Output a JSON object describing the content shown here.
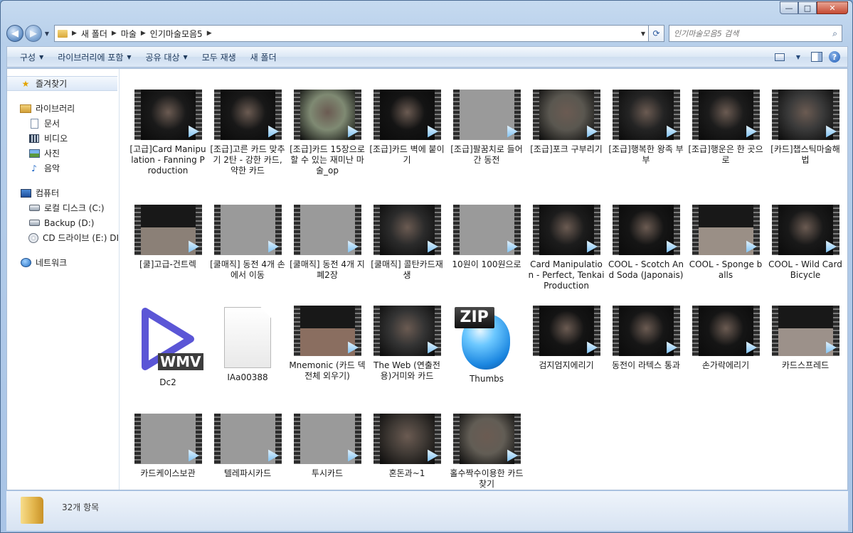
{
  "window": {
    "caption": {
      "minimize": "—",
      "maximize": "□",
      "close": "✕"
    }
  },
  "address": {
    "crumbs": [
      "새 폴더",
      "마술",
      "인기마술모음5"
    ],
    "search_placeholder": "인기마술모음5 검색"
  },
  "toolbar": {
    "organize": "구성",
    "include_library": "라이브러리에 포함",
    "share": "공유 대상",
    "play_all": "모두 재생",
    "new_folder": "새 폴더"
  },
  "nav": {
    "favorites": "즐겨찾기",
    "libraries": "라이브러리",
    "documents": "문서",
    "videos": "비디오",
    "pictures": "사진",
    "music": "음악",
    "computer": "컴퓨터",
    "local_disk": "로컬 디스크 (C:)",
    "backup": "Backup (D:)",
    "cd_drive": "CD 드라이브 (E:) DI",
    "network": "네트워크"
  },
  "files": [
    {
      "name": "[고급]Card Manipulation - Fanning Production",
      "type": "video"
    },
    {
      "name": "[조급]고른 카드 맞추기 2탄 - 강한 카드, 약한 카드",
      "type": "video"
    },
    {
      "name": "[조급]카드 15장으로 할 수 있는 재미난 마술_op",
      "type": "video"
    },
    {
      "name": "[조급]카드 벽에 붙이기",
      "type": "video"
    },
    {
      "name": "[조급]팔꿈치로 들어간 동전",
      "type": "video-blank"
    },
    {
      "name": "[조급]포크 구부리기",
      "type": "video"
    },
    {
      "name": "[조급]행복한 왕족 부부",
      "type": "video"
    },
    {
      "name": "[조급]행운은 한 곳으로",
      "type": "video"
    },
    {
      "name": "[카드]챕스틱마술해법",
      "type": "video"
    },
    {
      "name": "[쿨]고급-건트렉",
      "type": "video"
    },
    {
      "name": "[쿨매직] 동전 4개 손에서 이동",
      "type": "video-blank"
    },
    {
      "name": "[쿨매직] 동전 4개 지폐2장",
      "type": "video-blank"
    },
    {
      "name": "[쿨매직] 콜탄카드재생",
      "type": "video"
    },
    {
      "name": "10원이 100원으로",
      "type": "video-blank"
    },
    {
      "name": "Card Manipulation - Perfect, Tenkai Production",
      "type": "video"
    },
    {
      "name": "COOL - Scotch And Soda (Japonais)",
      "type": "video"
    },
    {
      "name": "COOL - Sponge balls",
      "type": "video"
    },
    {
      "name": "COOL - Wild Card Bicycle",
      "type": "video"
    },
    {
      "name": "Dc2",
      "type": "wmv"
    },
    {
      "name": "IAa00388",
      "type": "blank"
    },
    {
      "name": "Mnemonic (카드 덱 전체 외우기)",
      "type": "video"
    },
    {
      "name": "The Web (연출전용)거미와 카드",
      "type": "video"
    },
    {
      "name": "Thumbs",
      "type": "zip"
    },
    {
      "name": "검지엄지에리기",
      "type": "video"
    },
    {
      "name": "동전이 라텍스 통과",
      "type": "video"
    },
    {
      "name": "손가락에리기",
      "type": "video"
    },
    {
      "name": "카드스프레드",
      "type": "video"
    },
    {
      "name": "카드케이스보관",
      "type": "video-blank"
    },
    {
      "name": "텔레파시카드",
      "type": "video-blank"
    },
    {
      "name": "투시카드",
      "type": "video-blank"
    },
    {
      "name": "혼돈과~1",
      "type": "video"
    },
    {
      "name": "홀수짝수이용한 카드찾기",
      "type": "video"
    }
  ],
  "labels": {
    "wmv_badge": "WMV",
    "zip_badge": "ZIP"
  },
  "status": {
    "count": "32개 항목"
  }
}
